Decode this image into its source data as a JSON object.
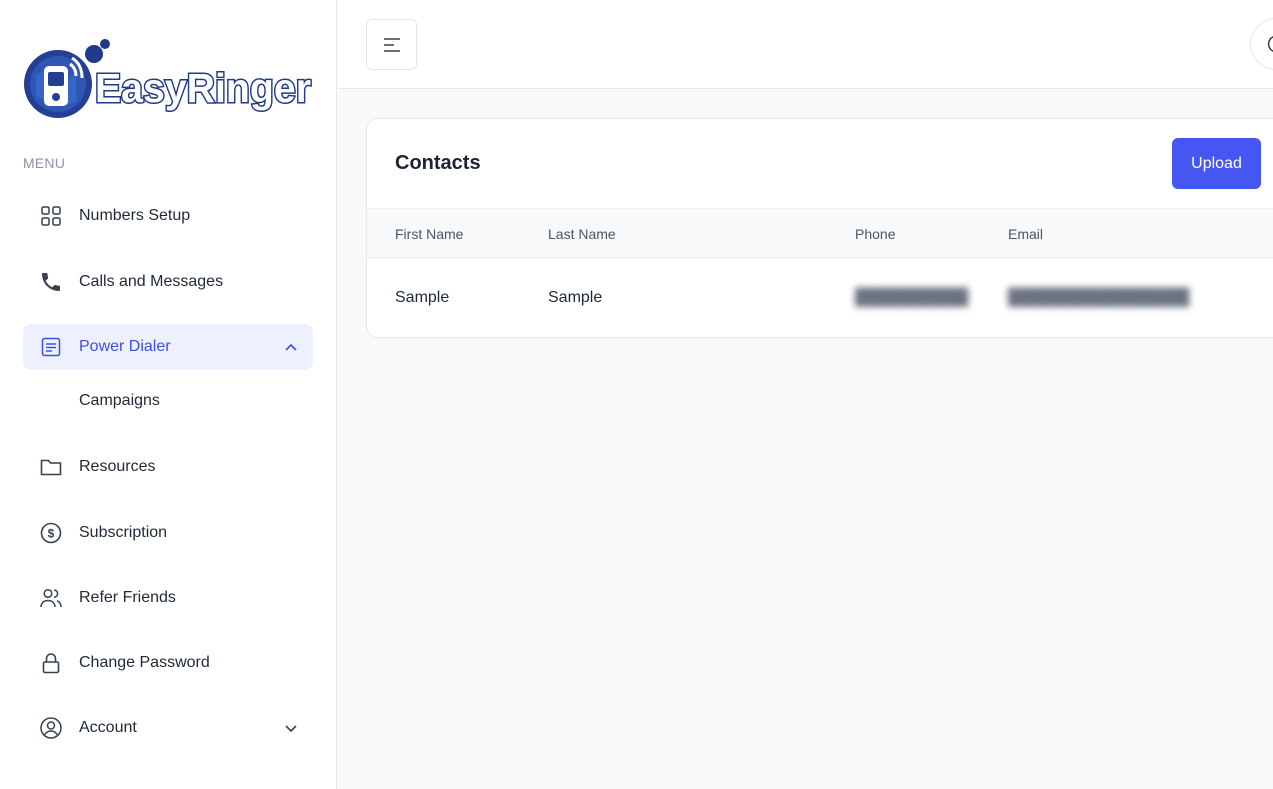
{
  "brand": {
    "name": "EasyRinger"
  },
  "sidebar": {
    "menu_heading": "MENU",
    "items": [
      {
        "label": "Numbers Setup",
        "icon": "grid-icon"
      },
      {
        "label": "Calls and Messages",
        "icon": "phone-icon"
      },
      {
        "label": "Power Dialer",
        "icon": "list-icon",
        "active": true,
        "expanded": true,
        "children": [
          {
            "label": "Campaigns"
          }
        ]
      },
      {
        "label": "Resources",
        "icon": "folder-icon"
      },
      {
        "label": "Subscription",
        "icon": "dollar-circle-icon"
      },
      {
        "label": "Refer Friends",
        "icon": "users-icon"
      },
      {
        "label": "Change Password",
        "icon": "lock-icon"
      },
      {
        "label": "Account",
        "icon": "user-circle-icon",
        "expanded": false
      }
    ]
  },
  "main": {
    "title": "Contacts",
    "upload_label": "Upload",
    "table": {
      "columns": [
        "First Name",
        "Last Name",
        "Phone",
        "Email"
      ],
      "rows": [
        {
          "first_name": "Sample",
          "last_name": "Sample",
          "phone": "",
          "email": ""
        }
      ]
    }
  },
  "colors": {
    "accent": "#3c50e0",
    "button": "#4656f3",
    "active_bg": "#edf1fd"
  }
}
